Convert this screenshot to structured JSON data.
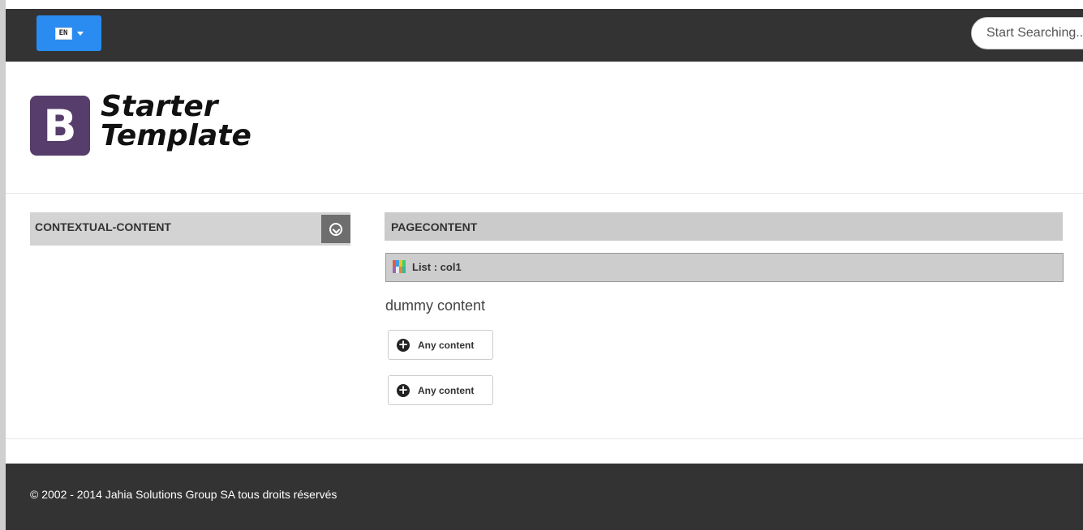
{
  "topbar": {
    "language_flag": "EN",
    "search_placeholder": "Start Searching..."
  },
  "logo": {
    "mark": "B",
    "line1": "Starter",
    "line2": "Template"
  },
  "sidebar": {
    "title": "CONTEXTUAL-CONTENT",
    "toggle_icon": "chevron-circle-down-icon"
  },
  "main": {
    "title": "PAGECONTENT",
    "list_label": "List : col1",
    "dummy_text": "dummy content",
    "buttons": [
      {
        "label": "Any content",
        "icon": "plus-circle-icon"
      },
      {
        "label": "Any content",
        "icon": "plus-circle-icon"
      }
    ]
  },
  "footer": {
    "copyright": "© 2002 - 2014 Jahia Solutions Group SA tous droits réservés"
  },
  "colors": {
    "topbar_bg": "#333333",
    "language_button": "#2a8cf0",
    "logo_mark_bg": "#563d6b",
    "footer_bg": "#333333"
  }
}
